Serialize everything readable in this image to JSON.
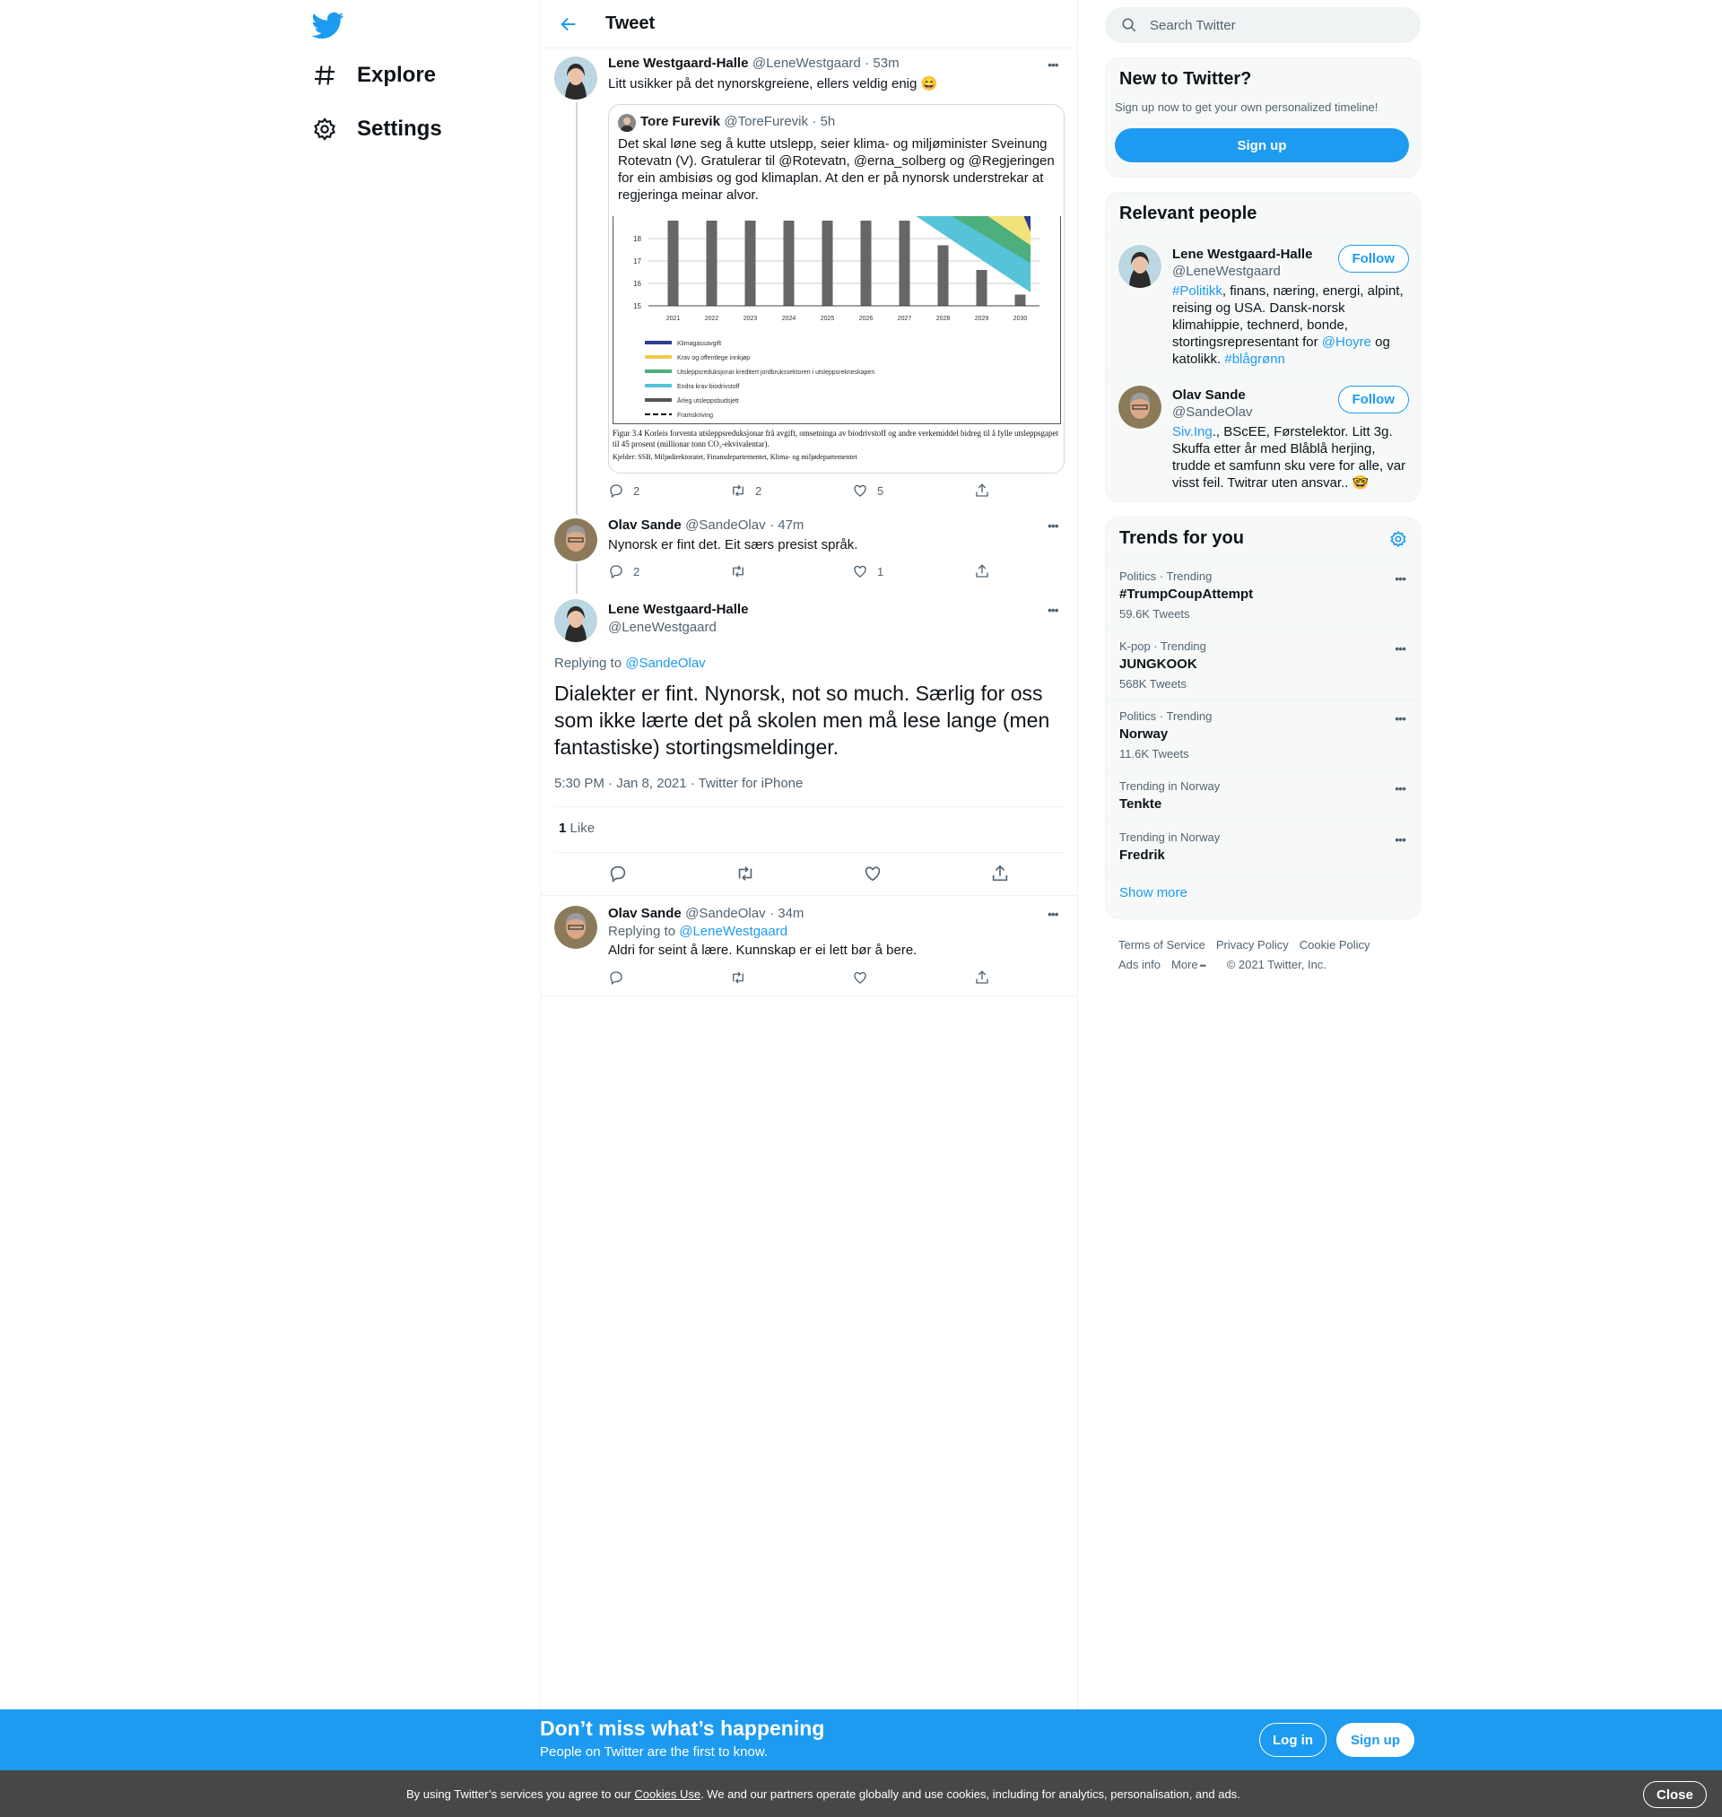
{
  "nav": {
    "explore": "Explore",
    "settings": "Settings"
  },
  "header": {
    "title": "Tweet"
  },
  "tweets": [
    {
      "name": "Lene Westgaard-Halle",
      "handle": "@LeneWestgaard",
      "time": "· 53m",
      "text": "Litt usikker på det nynorskgreiene, ellers veldig enig 😄",
      "quote": {
        "name": "Tore Furevik",
        "handle": "@ToreFurevik",
        "time": "· 5h",
        "text": "Det skal løne seg å kutte utslepp, seier klima- og miljøminister Sveinung Rotevatn (V). Gratulerar til @Rotevatn, @erna_solberg og @Regjeringen for ein ambisiøs og god klimaplan. At den er på nynorsk understrekar at regjeringa meinar alvor."
      },
      "replies": "2",
      "retweets": "2",
      "likes": "5"
    },
    {
      "name": "Olav Sande",
      "handle": "@SandeOlav",
      "time": "· 47m",
      "text": "Nynorsk er fint det. Eit særs presist språk.",
      "replies": "2",
      "retweets": "",
      "likes": "1"
    }
  ],
  "main_tweet": {
    "name": "Lene Westgaard-Halle",
    "handle": "@LeneWestgaard",
    "replying_label": "Replying to",
    "replying_to": "@SandeOlav",
    "text": "Dialekter er fint. Nynorsk, not so much. Særlig for oss som ikke lærte det på skolen men må lese lange (men fantastiske) stortingsmeldinger.",
    "meta": "5:30 PM · Jan 8, 2021 · Twitter for iPhone",
    "like_count": "1",
    "like_label": "Like"
  },
  "reply": {
    "name": "Olav Sande",
    "handle": "@SandeOlav",
    "time": "· 34m",
    "replying_label": "Replying to",
    "replying_to": "@LeneWestgaard",
    "text": "Aldri for seint å lære. Kunnskap er ei lett bør å bere."
  },
  "chart_data": {
    "type": "bar",
    "categories": [
      "2021",
      "2022",
      "2023",
      "2024",
      "2025",
      "2026",
      "2027",
      "2028",
      "2029",
      "2030"
    ],
    "values": [
      18.8,
      18.8,
      18.8,
      18.8,
      18.8,
      18.8,
      18.8,
      17.7,
      16.6,
      15.5
    ],
    "ylim": [
      15,
      19
    ],
    "yticks": [
      "15",
      "16",
      "17",
      "18"
    ],
    "legend": [
      "Klimagassavgift",
      "Krav og offentlege innkjøp",
      "Utsleppsreduksjonar kreditert jordbrukssektoren i utsleppsrekneskapen",
      "Endra krav biodrivstoff",
      "Årleg utsleppsbudsjett",
      "Framskriving"
    ],
    "legend_colors": [
      "#2b3f8f",
      "#f2c94c",
      "#4caf7d",
      "#56c4d8",
      "#555555",
      "#000000"
    ],
    "caption": "Figur 3.4  Korleis forventa utsleppsreduksjonar frå avgift, omsetninga av biodrivstoff og andre verkemiddel bidreg til å fylle utsleppsgapet til 45 prosent (millionar tonn CO₂-ekvivalentar).",
    "source": "Kjelder: SSB, Miljødirektoratet, Finansdepartementet, Klima- og miljødepartementet"
  },
  "search": {
    "placeholder": "Search Twitter"
  },
  "new_to_twitter": {
    "title": "New to Twitter?",
    "subtitle": "Sign up now to get your own personalized timeline!",
    "button": "Sign up"
  },
  "relevant": {
    "title": "Relevant people",
    "people": [
      {
        "name": "Lene Westgaard-Halle",
        "handle": "@LeneWestgaard",
        "follow": "Follow",
        "bio_link1": "#Politikk",
        "bio_part1": ", finans, næring, energi, alpint, reising og USA. Dansk-norsk klimahippie, technerd, bonde, stortingsrepresentant for ",
        "bio_link2": "@Hoyre",
        "bio_part2": " og katolikk. ",
        "bio_link3": "#blågrønn"
      },
      {
        "name": "Olav Sande",
        "handle": "@SandeOlav",
        "follow": "Follow",
        "bio_link1": "Siv.Ing",
        "bio_part1": "., BScEE, Førstelektor. Litt 3g. Skuffa etter år med Blåblå herjing, trudde et samfunn sku vere for alle, var visst feil. Twitrar uten ansvar.. 🤓"
      }
    ]
  },
  "trends": {
    "title": "Trends for you",
    "items": [
      {
        "context": "Politics · Trending",
        "title": "#TrumpCoupAttempt",
        "count": "59.6K Tweets"
      },
      {
        "context": "K-pop · Trending",
        "title": "JUNGKOOK",
        "count": "568K Tweets"
      },
      {
        "context": "Politics · Trending",
        "title": "Norway",
        "count": "11.6K Tweets"
      },
      {
        "context": "Trending in Norway",
        "title": "Tenkte",
        "count": ""
      },
      {
        "context": "Trending in Norway",
        "title": "Fredrik",
        "count": ""
      }
    ],
    "show_more": "Show more"
  },
  "footer": {
    "terms": "Terms of Service",
    "privacy": "Privacy Policy",
    "cookie": "Cookie Policy",
    "ads": "Ads info",
    "more": "More",
    "copyright": "© 2021 Twitter, Inc."
  },
  "banner": {
    "title": "Don’t miss what’s happening",
    "subtitle": "People on Twitter are the first to know.",
    "login": "Log in",
    "signup": "Sign up"
  },
  "cookie": {
    "pre": "By using Twitter’s services you agree to our ",
    "link": "Cookies Use",
    "post": ". We and our partners operate globally and use cookies, including for analytics, personalisation, and ads.",
    "close": "Close"
  },
  "colors": {
    "accent": "#1d9bf0",
    "text": "#0f1419",
    "muted": "#536471"
  }
}
